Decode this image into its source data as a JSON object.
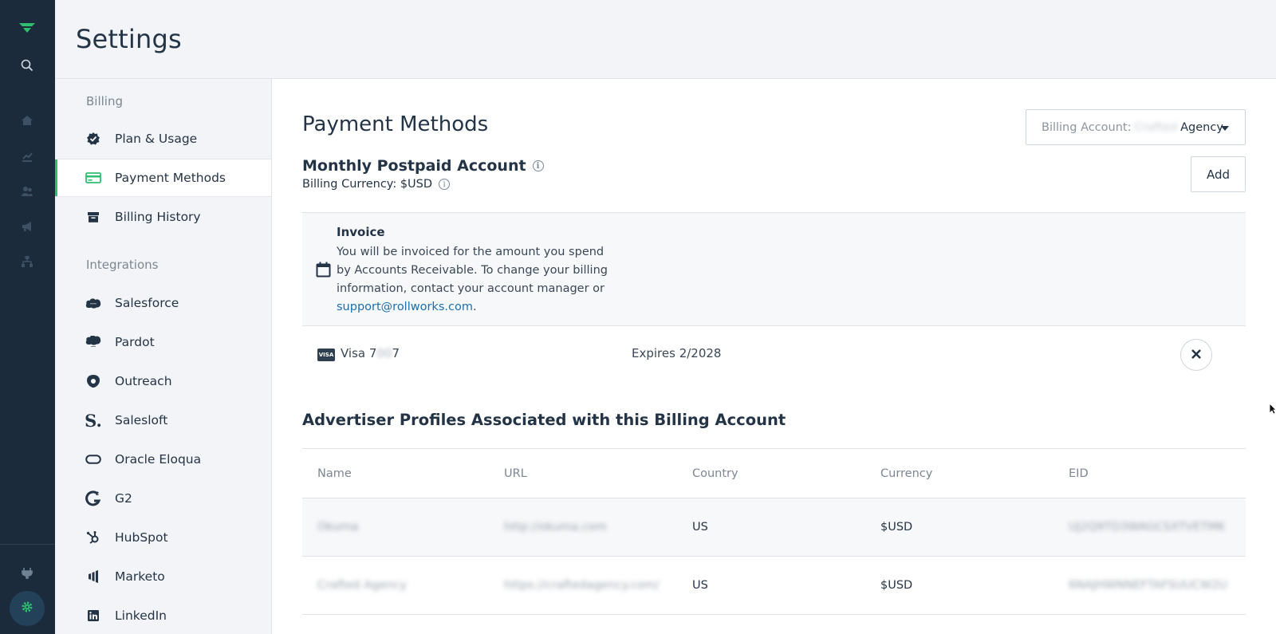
{
  "header": {
    "title": "Settings"
  },
  "rail": {
    "icons": [
      "logo-icon",
      "search-icon",
      "home-icon",
      "chart-icon",
      "audience-icon",
      "megaphone-icon",
      "hierarchy-icon",
      "plug-icon",
      "gear-icon"
    ]
  },
  "nav": {
    "sections": [
      {
        "label": "Billing",
        "items": [
          {
            "label": "Plan & Usage",
            "icon": "badge-check-icon"
          },
          {
            "label": "Payment Methods",
            "icon": "credit-card-icon",
            "active": true
          },
          {
            "label": "Billing History",
            "icon": "archive-box-icon"
          }
        ]
      },
      {
        "label": "Integrations",
        "items": [
          {
            "label": "Salesforce",
            "icon": "salesforce-icon"
          },
          {
            "label": "Pardot",
            "icon": "pardot-icon"
          },
          {
            "label": "Outreach",
            "icon": "outreach-icon"
          },
          {
            "label": "Salesloft",
            "icon": "salesloft-icon"
          },
          {
            "label": "Oracle Eloqua",
            "icon": "eloqua-icon"
          },
          {
            "label": "G2",
            "icon": "g2-icon"
          },
          {
            "label": "HubSpot",
            "icon": "hubspot-icon"
          },
          {
            "label": "Marketo",
            "icon": "marketo-icon"
          },
          {
            "label": "LinkedIn",
            "icon": "linkedin-icon"
          }
        ]
      }
    ]
  },
  "main": {
    "title": "Payment Methods",
    "billing_account": {
      "label": "Billing Account:",
      "value_blurred": "Crafted",
      "value": "Agency"
    },
    "account": {
      "title": "Monthly Postpaid Account",
      "currency": "Billing Currency: $USD",
      "add_label": "Add"
    },
    "invoice": {
      "title": "Invoice",
      "text": "You will be invoiced for the amount you spend by Accounts Receivable. To change your billing information, contact your account manager or",
      "email": "support@rollworks.com",
      "suffix": "."
    },
    "card": {
      "brand": "VISA",
      "name_prefix": "Visa 7",
      "name_blurred": "00",
      "name_suffix": "7",
      "expires": "Expires 2/2028"
    },
    "advertisers": {
      "title": "Advertiser Profiles Associated with this Billing Account",
      "columns": [
        "Name",
        "URL",
        "Country",
        "Currency",
        "EID"
      ],
      "rows": [
        [
          "Okuma",
          "http://okuma.com",
          "US",
          "$USD",
          "UJ2Q9TD3WAGCSXTVETMK"
        ],
        [
          "Crafted Agency",
          "https://craftedagency.com/",
          "US",
          "$USD",
          "6NAJHWNNEFTAFSUUCW2U"
        ]
      ]
    }
  }
}
